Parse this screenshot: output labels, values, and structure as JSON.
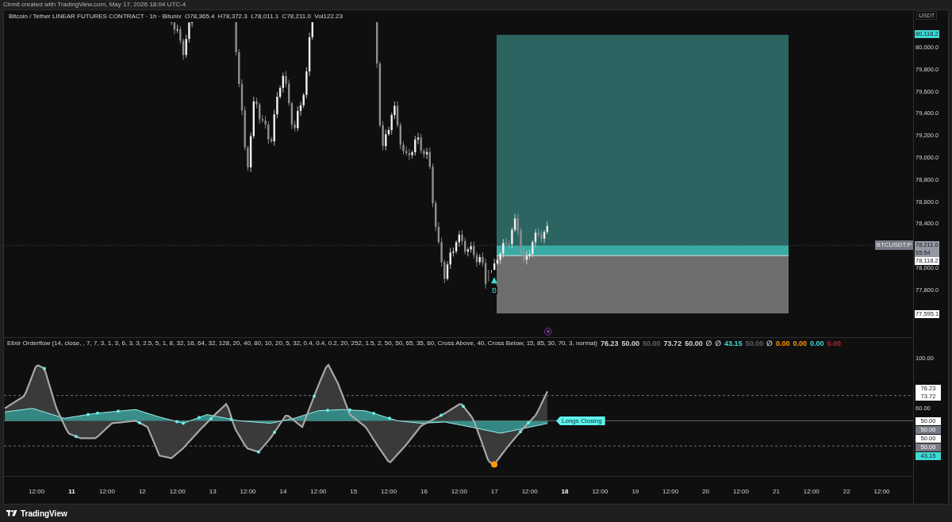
{
  "header": {
    "text": "Cirmit created with TradingView.com, May 17, 2026 18:04 UTC-4"
  },
  "main_pane": {
    "legend": {
      "title": "Bitcoin / Tether LINEAR FUTURES CONTRACT · 1h · Bitunix",
      "values": [
        "O78,365.4",
        "H78,372.3",
        "L78,011.1",
        "C78,211.0",
        "Vol122.23"
      ]
    },
    "marker": {
      "label": "B"
    },
    "price_axis": {
      "currency": "USDT",
      "ticks": [
        "80,000.0",
        "79,800.0",
        "79,600.0",
        "79,400.0",
        "79,200.0",
        "79,000.0",
        "78,800.0",
        "78,600.0",
        "78,400.0",
        "78,000.0",
        "77,800.0"
      ],
      "symbol_tag": "BTCUSDT.P",
      "badges": [
        {
          "text": "80,118.2",
          "color": "#3fd9d4"
        },
        {
          "text": "78,211.0",
          "subtext": "55:54",
          "color": "#9598a1"
        },
        {
          "text": "78,118.2",
          "color": "#ffffff"
        },
        {
          "text": "77,595.1",
          "color": "#ffffff"
        }
      ]
    }
  },
  "indicator_pane": {
    "legend": {
      "title": "Elixir Orderflow (14, close, , 7, 7, 3, 1, 3, 6, 3, 3, 2.5, 5, 1, 8, 32, 16, 64, 32, 128, 20, 40, 80, 10, 20, 5, 32, 0.4, 0.4, 0.2, 20, 252, 1.5, 2, 50, 50, 65, 35, 60, Cross Above, 40, Cross Below, 15, 85, 30, 70, 3, normal)",
      "values": [
        {
          "text": "76.23",
          "color": "#d1d4dc"
        },
        {
          "text": "50.00",
          "color": "#d1d4dc"
        },
        {
          "text": "50.00",
          "color": "#5d606b"
        },
        {
          "text": "73.72",
          "color": "#d1d4dc"
        },
        {
          "text": "50.00",
          "color": "#d1d4dc"
        },
        {
          "text": "∅"
        },
        {
          "text": "∅"
        },
        {
          "text": "43.15",
          "color": "#3fd9d4"
        },
        {
          "text": "50.00",
          "color": "#5d606b"
        },
        {
          "text": "∅"
        },
        {
          "text": "0.00",
          "color": "#ff9800"
        },
        {
          "text": "0.00",
          "color": "#ff9800"
        },
        {
          "text": "0.00",
          "color": "#3fd9d4"
        },
        {
          "text": "0.00",
          "color": "#b22833"
        }
      ]
    },
    "signal_tag": "Longs Closing",
    "axis": {
      "ticks": [
        "100.00",
        "60.00"
      ],
      "badges": [
        {
          "text": "76.23",
          "color": "#ffffff"
        },
        {
          "text": "73.72",
          "color": "#ffffff"
        },
        {
          "text": "50.00",
          "color": "#ffffff"
        },
        {
          "text": "50.00",
          "color": "#787b86"
        },
        {
          "text": "50.00",
          "color": "#ffffff"
        },
        {
          "text": "50.00",
          "color": "#787b86"
        },
        {
          "text": "43.15",
          "color": "#3fd9d4"
        }
      ]
    }
  },
  "time_axis": {
    "labels": [
      {
        "text": "12:00",
        "bold": false
      },
      {
        "text": "11",
        "bold": true
      },
      {
        "text": "12:00",
        "bold": false
      },
      {
        "text": "12",
        "bold": false
      },
      {
        "text": "12:00",
        "bold": false
      },
      {
        "text": "13",
        "bold": false
      },
      {
        "text": "12:00",
        "bold": false
      },
      {
        "text": "14",
        "bold": false
      },
      {
        "text": "12:00",
        "bold": false
      },
      {
        "text": "15",
        "bold": false
      },
      {
        "text": "12:00",
        "bold": false
      },
      {
        "text": "16",
        "bold": false
      },
      {
        "text": "12:00",
        "bold": false
      },
      {
        "text": "17",
        "bold": false
      },
      {
        "text": "12:00",
        "bold": false
      },
      {
        "text": "18",
        "bold": true
      },
      {
        "text": "12:00",
        "bold": false
      },
      {
        "text": "19",
        "bold": false
      },
      {
        "text": "12:00",
        "bold": false
      },
      {
        "text": "20",
        "bold": false
      },
      {
        "text": "12:00",
        "bold": false
      },
      {
        "text": "21",
        "bold": false
      },
      {
        "text": "12:00",
        "bold": false
      },
      {
        "text": "22",
        "bold": false
      },
      {
        "text": "12:00",
        "bold": false
      }
    ]
  },
  "footer": {
    "brand": "TradingView"
  }
}
